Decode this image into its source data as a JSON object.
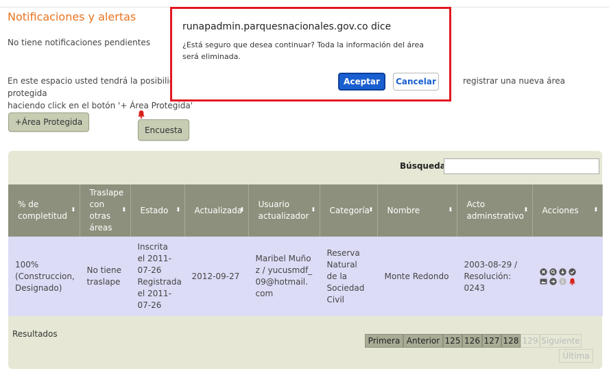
{
  "page": {
    "title": "Notificaciones y alertas",
    "no_notifications": "No tiene notificaciones pendientes",
    "info_text": "En este espacio usted tendrá la posibilidad ... registrar una nueva área protegida haciendo click en el botón '+ Área Protegida'",
    "info_line1_left": "En este espacio usted tendrá la posibilidad",
    "info_line1_right": "registrar una nueva área protegida",
    "info_line2": "haciendo click en el botón '+ Área Protegida'"
  },
  "buttons": {
    "add_area": "+Área Protegida",
    "survey": "Encuesta"
  },
  "search": {
    "label": "Búsqueda:",
    "value": ""
  },
  "table": {
    "headers": [
      "% de completitud",
      "Traslape con otras áreas",
      "Estado",
      "Actualizada",
      "Usuario actualizador",
      "Categoría",
      "Nombre",
      "Acto adminstrativo",
      "Acciones"
    ],
    "rows": [
      {
        "completitud": "100% (Construccion, Designado)",
        "traslape": "No tiene traslape",
        "estado": "Inscrita el 2011-07-26 Registrada el 2011-07-26",
        "actualizada": "2012-09-27",
        "usuario": "Maribel Muñoz / yucusmdf_09@hotmail.com",
        "categoria": "Reserva Natural de la Sociedad Civil",
        "nombre": "Monte Redondo",
        "acto": "2003-08-29 / Resolución: 0243"
      }
    ]
  },
  "results_label": "Resultados",
  "pagination": [
    "Primera",
    "Anterior",
    "125",
    "126",
    "127",
    "128",
    "129",
    "Siguiente",
    "Última"
  ],
  "dialog": {
    "title": "runapadmin.parquesnacionales.gov.co dice",
    "message": "¿Está seguro que desea continuar? Toda la información del área será eliminada.",
    "ok": "Aceptar",
    "cancel": "Cancelar"
  },
  "colors": {
    "accent": "#e8731f",
    "header_bg": "#8d907c",
    "row_bg": "#dcdcf7",
    "dialog_border": "#e2171f",
    "primary": "#1a5fd0"
  }
}
